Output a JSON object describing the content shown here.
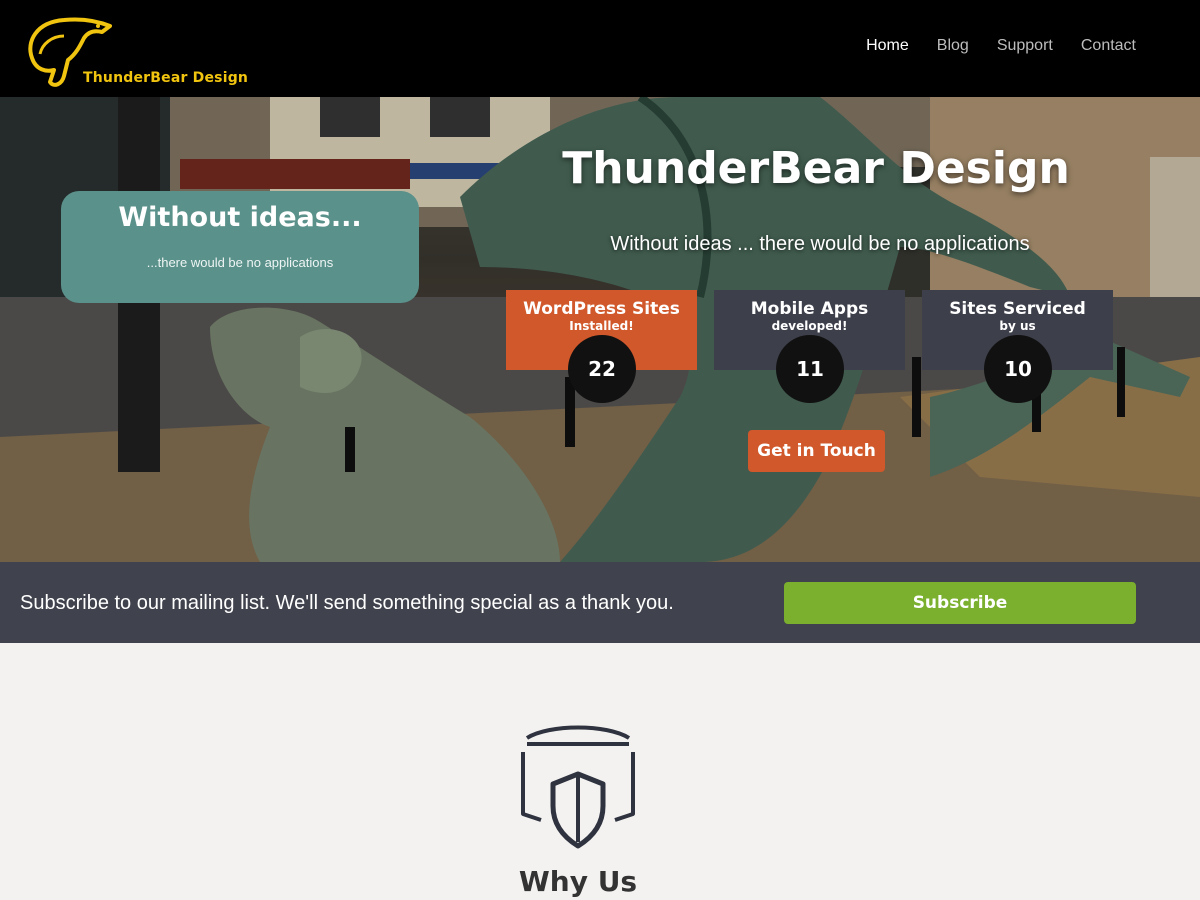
{
  "header": {
    "logo_text": "ThunderBear Design",
    "nav": [
      {
        "label": "Home",
        "active": true
      },
      {
        "label": "Blog",
        "active": false
      },
      {
        "label": "Support",
        "active": false
      },
      {
        "label": "Contact",
        "active": false
      }
    ]
  },
  "hero": {
    "callout": {
      "title": "Without ideas...",
      "subtitle": "...there would be no applications"
    },
    "title": "ThunderBear Design",
    "subtitle": "Without ideas ... there would be no applications",
    "stats": [
      {
        "title": "WordPress Sites",
        "subtitle": "Installed!",
        "value": "22",
        "color": "#d0582a"
      },
      {
        "title": "Mobile Apps",
        "subtitle": "developed!",
        "value": "11",
        "color": "#3d3f4a"
      },
      {
        "title": "Sites Serviced",
        "subtitle": "by us",
        "value": "10",
        "color": "#3d3f4a"
      }
    ],
    "cta_label": "Get in Touch"
  },
  "subscribe": {
    "text": "Subscribe to our mailing list. We'll send something special as a thank you.",
    "button_label": "Subscribe"
  },
  "why": {
    "icon": "shield-browser-icon",
    "title": "Why Us"
  },
  "colors": {
    "accent_orange": "#d0582a",
    "teal": "#5a918a",
    "subscribe_green": "#7bb02f",
    "dark_bar": "#40434d",
    "logo_yellow": "#f1c40f"
  }
}
